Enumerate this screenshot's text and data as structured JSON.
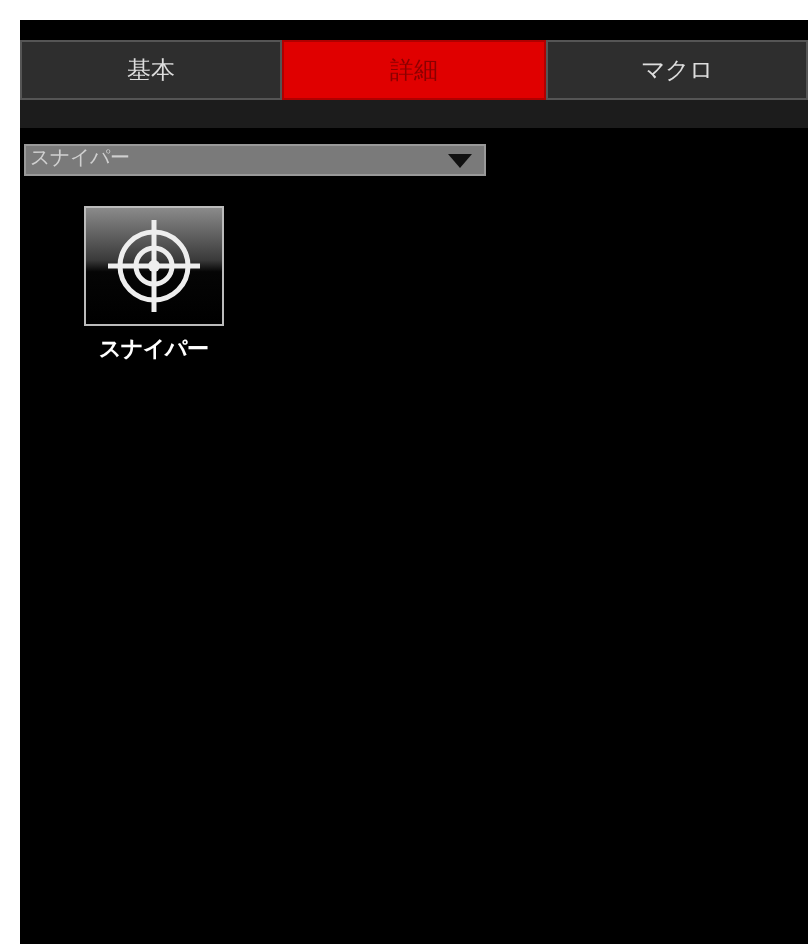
{
  "tabs": [
    {
      "label": "基本",
      "selected": false
    },
    {
      "label": "詳細",
      "selected": true
    },
    {
      "label": "マクロ",
      "selected": false
    }
  ],
  "dropdown": {
    "value": "スナイパー"
  },
  "items": [
    {
      "label": "スナイパー",
      "selected": false
    }
  ]
}
